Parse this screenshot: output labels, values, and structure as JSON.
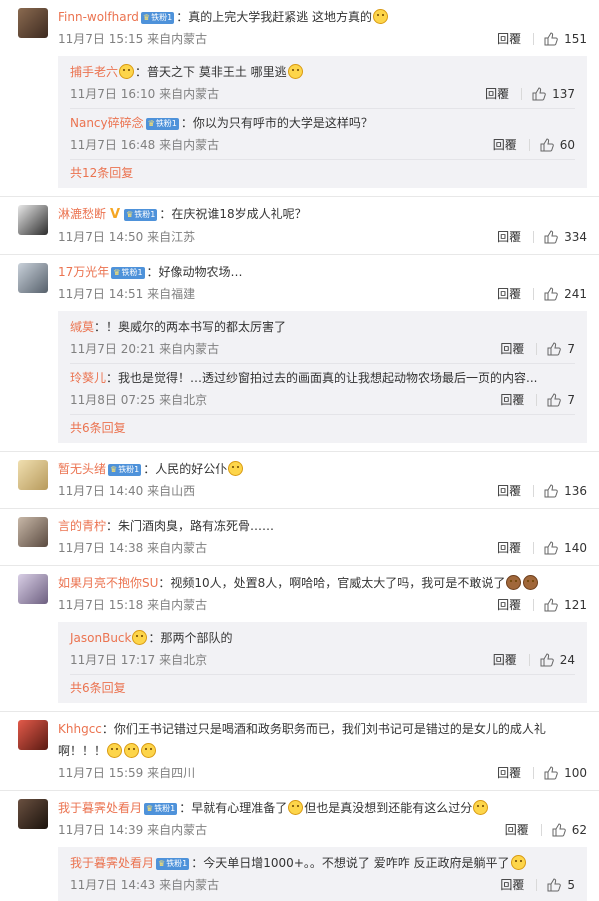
{
  "reply_label": "回覆",
  "comments": [
    {
      "user": "Finn-wolfhard",
      "badge": "铁粉1",
      "text": "：真的上完大学我赶紧逃 这地方真的",
      "time": "11月7日 15:15 来自内蒙古",
      "likes": "151",
      "avatar_color": "#6b4f3e",
      "replies": [
        {
          "user": "捕手老六",
          "text": "：普天之下 莫非王土 哪里逃",
          "time": "11月7日 16:10 来自内蒙古",
          "likes": "137"
        },
        {
          "user": "Nancy碎碎念",
          "badge": "铁粉1",
          "text": "：你以为只有呼市的大学是这样吗？",
          "time": "11月7日 16:48 来自内蒙古",
          "likes": "60"
        }
      ],
      "more": "共12条回复"
    },
    {
      "user": "淋漉愁断",
      "badge": "铁粉1",
      "text": "：在庆祝谁18岁成人礼呢？",
      "time": "11月7日 14:50 来自江苏",
      "likes": "334",
      "avatar_color": "#2c2c2c"
    },
    {
      "user": "17万光年",
      "badge": "铁粉1",
      "text": "：好像动物农场…",
      "time": "11月7日 14:51 来自福建",
      "likes": "241",
      "avatar_color": "#7d8a99",
      "replies": [
        {
          "user": "缄莫",
          "text": "：！奥威尔的两本书写的都太厉害了",
          "time": "11月7日 20:21 来自内蒙古",
          "likes": "7"
        },
        {
          "user": "玲葵儿",
          "text": "：我也是觉得！…透过纱窗拍过去的画面真的让我想起动物农场最后一页的内容...",
          "time": "11月8日 07:25 来自北京",
          "likes": "7"
        }
      ],
      "more": "共6条回复"
    },
    {
      "user": "暂无头绪",
      "badge": "铁粉1",
      "text": "：人民的好公仆",
      "time": "11月7日 14:40 来自山西",
      "likes": "136",
      "avatar_color": "#d8c08a"
    },
    {
      "user": "言的青柠",
      "text": "：朱门酒肉臭，路有冻死骨……",
      "time": "11月7日 14:38 来自内蒙古",
      "likes": "140",
      "avatar_color": "#8c7b70"
    },
    {
      "user": "如果月亮不抱你SU",
      "text": "：视频10人，处置8人，啊哈哈，官威太大了吗，我可是不敢说了",
      "time": "11月7日 15:18 来自内蒙古",
      "likes": "121",
      "avatar_color": "#a08fb0",
      "replies": [
        {
          "user": "JasonBuck",
          "text": "：那两个部队的",
          "time": "11月7日 17:17 来自北京",
          "likes": "24"
        }
      ],
      "more": "共6条回复"
    },
    {
      "user": "Khhgcc",
      "text": "：你们王书记错过只是喝酒和政务职务而已，我们刘书记可是错过的是女儿的成人礼",
      "text2": "啊！！！",
      "time": "11月7日 15:59 来自四川",
      "likes": "100",
      "avatar_color": "#b03a2e"
    },
    {
      "user": "我于暮霁处看月",
      "badge": "铁粉1",
      "text": "：早就有心理准备了",
      "text_b": "但也是真没想到还能有这么过分",
      "time": "11月7日 14:39 来自内蒙古",
      "likes": "62",
      "avatar_color": "#3a2a20",
      "replies": [
        {
          "user": "我于暮霁处看月",
          "badge": "铁粉1",
          "text": "：今天单日增1000+。。不想说了 爱咋咋 反正政府是躺平了",
          "time": "11月7日 14:43 来自内蒙古",
          "likes": "5"
        }
      ]
    }
  ]
}
